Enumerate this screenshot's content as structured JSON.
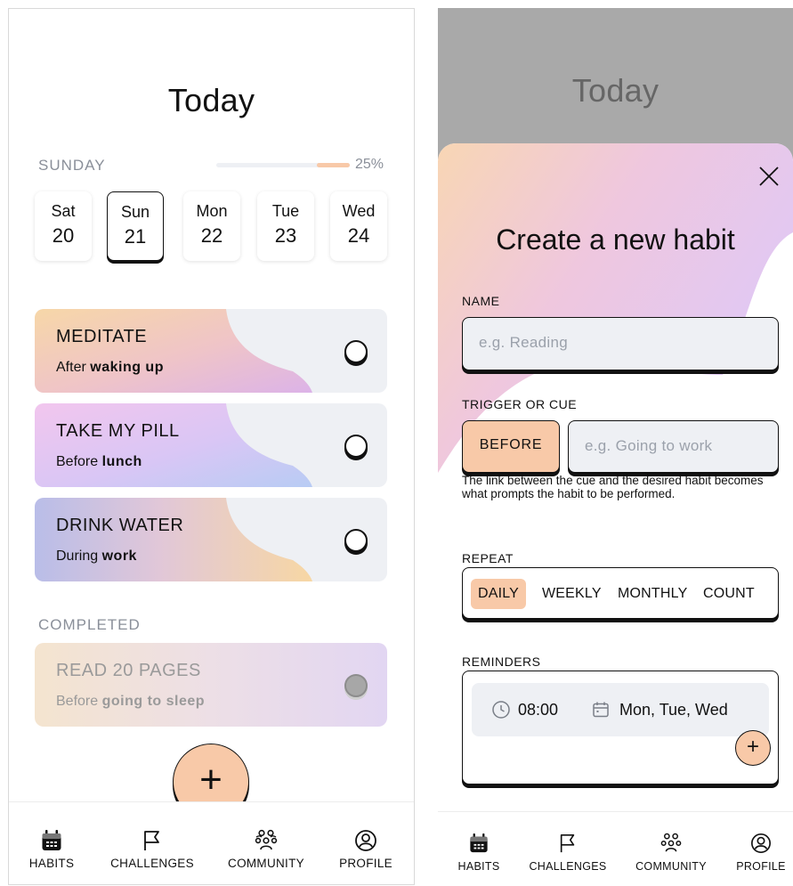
{
  "left": {
    "title": "Today",
    "day_label": "SUNDAY",
    "progress": 0.25,
    "progress_label": "25%",
    "dates": [
      {
        "name": "Sat",
        "num": "20"
      },
      {
        "name": "Sun",
        "num": "21",
        "selected": true
      },
      {
        "name": "Mon",
        "num": "22"
      },
      {
        "name": "Tue",
        "num": "23"
      },
      {
        "name": "Wed",
        "num": "24"
      }
    ],
    "habits": [
      {
        "title": "MEDITATE",
        "prefix": "After",
        "cue": "waking up"
      },
      {
        "title": "TAKE MY PILL",
        "prefix": "Before",
        "cue": "lunch"
      },
      {
        "title": "DRINK WATER",
        "prefix": "During",
        "cue": "work"
      }
    ],
    "completed_label": "COMPLETED",
    "completed": [
      {
        "title": "READ 20 PAGES",
        "prefix": "Before",
        "cue": "going to sleep"
      }
    ],
    "fab_label": "+"
  },
  "right": {
    "bg_title": "Today",
    "sheet_title": "Create a new habit",
    "name_label": "NAME",
    "name_placeholder": "e.g. Reading",
    "trigger_label": "TRIGGER OR CUE",
    "trigger_button": "BEFORE",
    "trigger_placeholder": "e.g. Going to work",
    "helper": "The link between the cue and the desired habit becomes what prompts the habit to be performed.",
    "repeat_label": "REPEAT",
    "repeat_options": [
      "DAILY",
      "WEEKLY",
      "MONTHLY",
      "COUNT"
    ],
    "reminders_label": "REMINDERS",
    "reminder_time": "08:00",
    "reminder_days": "Mon, Tue, Wed",
    "reminder_add": "+"
  },
  "tabs": [
    "HABITS",
    "CHALLENGES",
    "COMMUNITY",
    "PROFILE"
  ],
  "colors": {
    "accent": "#f8c9a8",
    "field_bg": "#eef0f4",
    "overlay": "#a9a9a9"
  }
}
